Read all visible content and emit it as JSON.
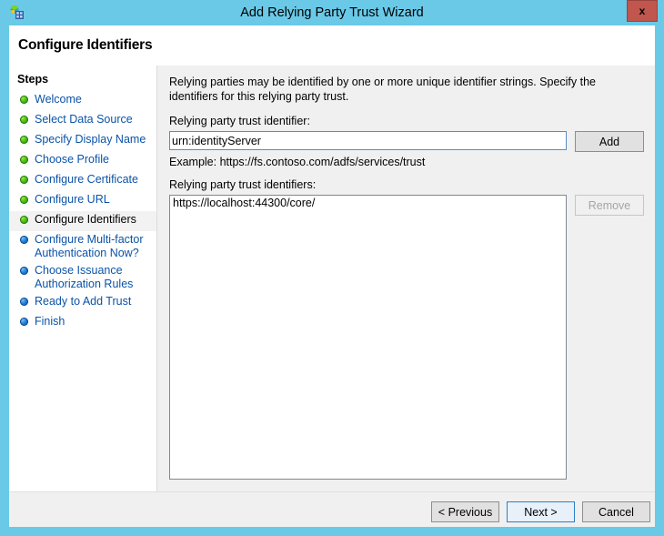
{
  "window": {
    "title": "Add Relying Party Trust Wizard",
    "icon": "adfs-globe-icon",
    "close_label": "x",
    "titlebar_color": "#6ac9e7",
    "close_color": "#c0564d"
  },
  "header": {
    "page_title": "Configure Identifiers"
  },
  "sidebar": {
    "heading": "Steps",
    "items": [
      {
        "label": "Welcome",
        "state": "done"
      },
      {
        "label": "Select Data Source",
        "state": "done"
      },
      {
        "label": "Specify Display Name",
        "state": "done"
      },
      {
        "label": "Choose Profile",
        "state": "done"
      },
      {
        "label": "Configure Certificate",
        "state": "done"
      },
      {
        "label": "Configure URL",
        "state": "done"
      },
      {
        "label": "Configure Identifiers",
        "state": "current"
      },
      {
        "label": "Configure Multi-factor\nAuthentication Now?",
        "state": "pending"
      },
      {
        "label": "Choose Issuance\nAuthorization Rules",
        "state": "pending"
      },
      {
        "label": "Ready to Add Trust",
        "state": "pending"
      },
      {
        "label": "Finish",
        "state": "pending"
      }
    ],
    "colors": {
      "link": "#0b53a8",
      "done_bullet": "#46c013",
      "pending_bullet": "#1f7fd8",
      "current_row_bg": "#f2f2f2"
    }
  },
  "main": {
    "intro_text": "Relying parties may be identified by one or more unique identifier strings. Specify the identifiers for this relying party trust.",
    "identifier_label": "Relying party trust identifier:",
    "identifier_value": "urn:identityServer",
    "identifier_placeholder": "",
    "add_label": "Add",
    "example_text": "Example: https://fs.contoso.com/adfs/services/trust",
    "identifiers_label": "Relying party trust identifiers:",
    "identifiers": [
      "https://localhost:44300/core/"
    ],
    "remove_label": "Remove",
    "remove_enabled": false
  },
  "footer": {
    "previous_label": "< Previous",
    "next_label": "Next >",
    "cancel_label": "Cancel",
    "default_button": "Next >"
  }
}
